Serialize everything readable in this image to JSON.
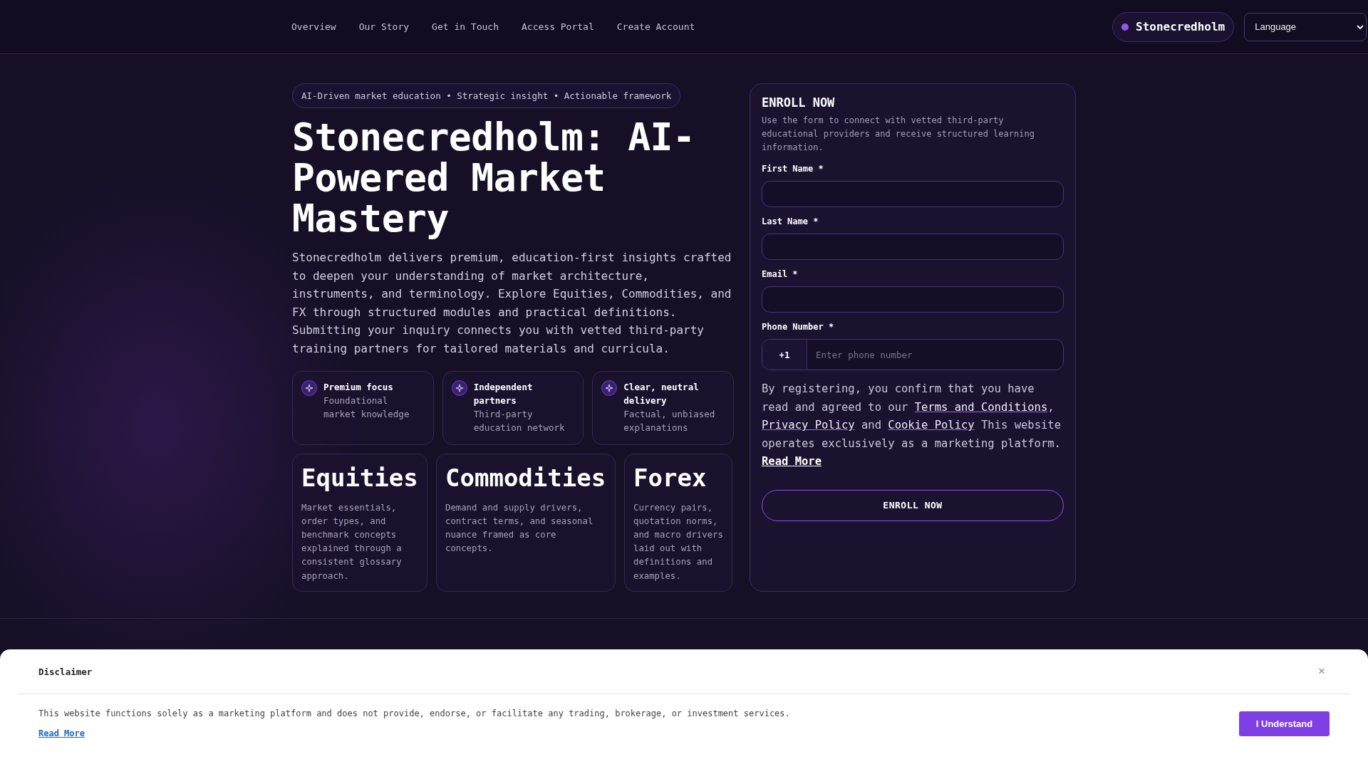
{
  "nav": {
    "links": [
      "Overview",
      "Our Story",
      "Get in Touch",
      "Access Portal",
      "Create Account"
    ],
    "brand": "Stonecredholm",
    "language": {
      "value": "Language"
    }
  },
  "hero": {
    "tagline": "AI-Driven market education • Strategic insight • Actionable framework",
    "title": "Stonecredholm: AI-Powered Market Mastery",
    "intro": "Stonecredholm delivers premium, education-first insights crafted to deepen your understanding of market architecture, instruments, and terminology. Explore Equities, Commodities, and FX through structured modules and practical definitions. Submitting your inquiry connects you with vetted third-party training partners for tailored materials and curricula.",
    "features": [
      {
        "title": "Premium focus",
        "text": "Foundational market knowledge"
      },
      {
        "title": "Independent partners",
        "text": "Third-party education network"
      },
      {
        "title": "Clear, neutral delivery",
        "text": "Factual, unbiased explanations"
      }
    ],
    "markets": [
      {
        "title": "Equities",
        "text": "Market essentials, order types, and benchmark concepts explained through a consistent glossary approach."
      },
      {
        "title": "Commodities",
        "text": "Demand and supply drivers, contract terms, and seasonal nuance framed as core concepts."
      },
      {
        "title": "Forex",
        "text": "Currency pairs, quotation norms, and macro drivers laid out with definitions and examples."
      }
    ]
  },
  "form": {
    "title": "ENROLL NOW",
    "subtitle": "Use the form to connect with vetted third-party educational providers and receive structured learning information.",
    "fields": [
      {
        "kind": "text",
        "label": "First Name *"
      },
      {
        "kind": "text",
        "label": "Last Name *"
      },
      {
        "kind": "text",
        "label": "Email *"
      },
      {
        "kind": "phone",
        "label": "Phone Number *",
        "prefix": "+1",
        "placeholder": "Enter phone number"
      }
    ],
    "consent": [
      {
        "kind": "text",
        "text": "By registering, you confirm that you have read and agreed to our "
      },
      {
        "kind": "link",
        "text": "Terms and Conditions"
      },
      {
        "kind": "text",
        "text": ", "
      },
      {
        "kind": "link",
        "text": "Privacy Policy"
      },
      {
        "kind": "text",
        "text": " and "
      },
      {
        "kind": "link",
        "text": "Cookie Policy"
      },
      {
        "kind": "text",
        "text": " This website operates exclusively as a marketing platform. "
      },
      {
        "kind": "strong_link",
        "text": "Read More"
      }
    ],
    "submit": "ENROLL NOW"
  },
  "disclaimer": {
    "title": "Disclaimer",
    "close": "×",
    "text": "This website functions solely as a marketing platform and does not provide, endorse, or facilitate any trading, brokerage, or investment services.",
    "link": "Read More",
    "button": "I Understand"
  }
}
